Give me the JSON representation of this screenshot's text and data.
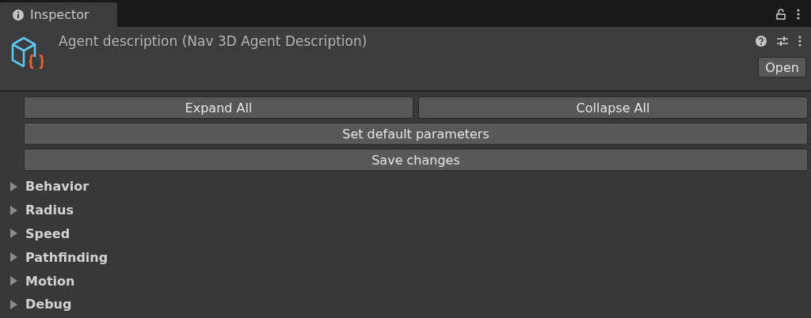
{
  "tab": {
    "label": "Inspector",
    "selected": true
  },
  "header": {
    "title": "Agent description (Nav 3D Agent Description)",
    "open_button": "Open"
  },
  "button_rows": [
    [
      "Expand All",
      "Collapse All"
    ],
    [
      "Set default parameters"
    ],
    [
      "Save changes"
    ]
  ],
  "sections": [
    {
      "label": "Behavior",
      "expanded": false
    },
    {
      "label": "Radius",
      "expanded": false
    },
    {
      "label": "Speed",
      "expanded": false
    },
    {
      "label": "Pathfinding",
      "expanded": false
    },
    {
      "label": "Motion",
      "expanded": false
    },
    {
      "label": "Debug",
      "expanded": false
    }
  ]
}
